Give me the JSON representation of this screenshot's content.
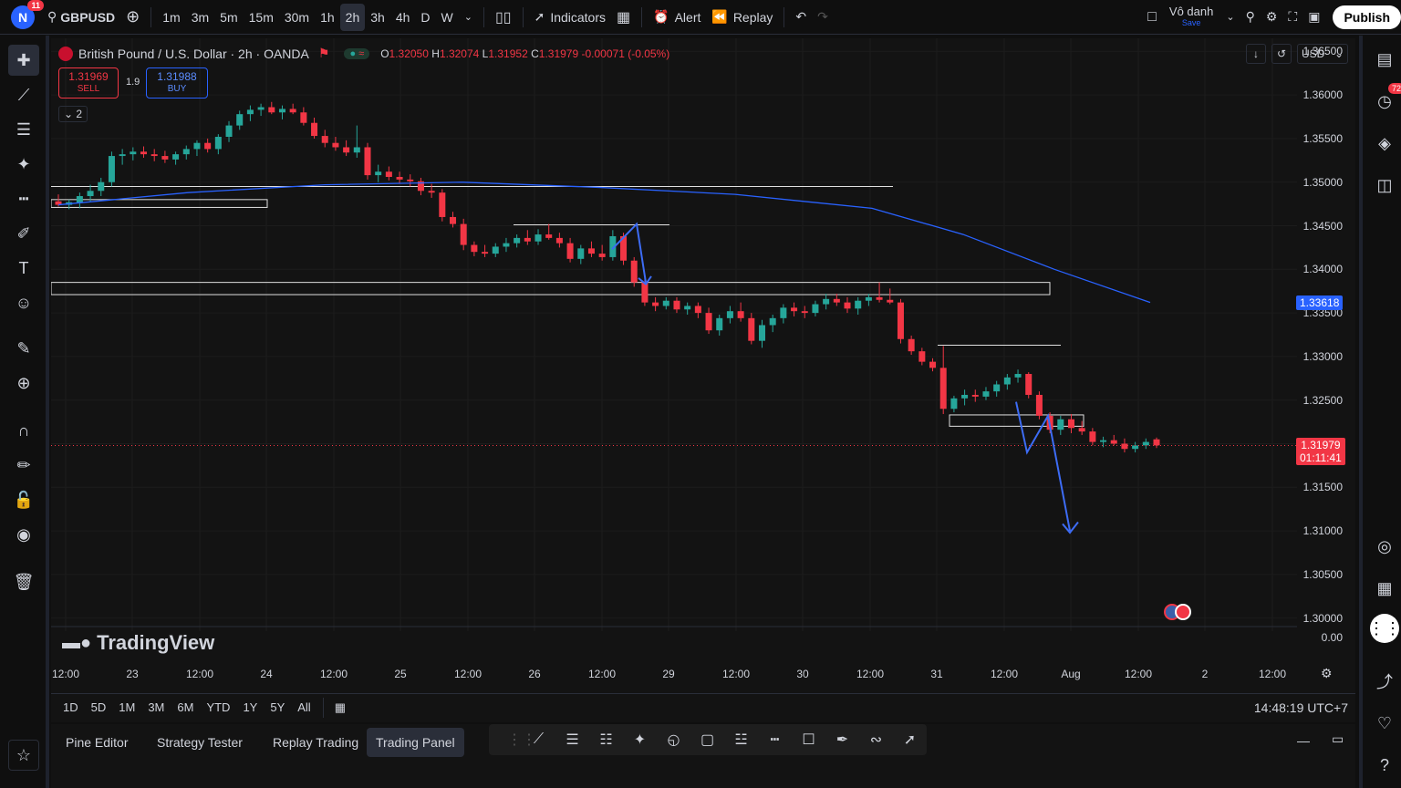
{
  "topbar": {
    "avatar_letter": "N",
    "avatar_badge": "11",
    "symbol": "GBPUSD",
    "timeframes": [
      "1m",
      "3m",
      "5m",
      "15m",
      "30m",
      "1h",
      "2h",
      "3h",
      "4h",
      "D",
      "W"
    ],
    "active_timeframe": "2h",
    "indicators_label": "Indicators",
    "alert_label": "Alert",
    "replay_label": "Replay",
    "layout_name": "Vô danh",
    "layout_status": "Save",
    "publish_label": "Publish"
  },
  "legend": {
    "title": "British Pound / U.S. Dollar · 2h · OANDA",
    "o_label": "O",
    "o": "1.32050",
    "h_label": "H",
    "h": "1.32074",
    "l_label": "L",
    "l": "1.31952",
    "c_label": "C",
    "c": "1.31979",
    "change": "-0.00071 (-0.05%)",
    "sell_price": "1.31969",
    "sell_label": "SELL",
    "spread": "1.9",
    "buy_price": "1.31988",
    "buy_label": "BUY",
    "indicator_count": "2"
  },
  "price_axis": {
    "currency": "USD",
    "ticks": [
      "1.36500",
      "1.36000",
      "1.35500",
      "1.35000",
      "1.34500",
      "1.34000",
      "1.33500",
      "1.33000",
      "1.32500",
      "1.32000",
      "1.31500",
      "1.31000",
      "1.30500",
      "1.30000",
      "0.00"
    ],
    "ma_tag": "1.33618",
    "last_price": "1.31979",
    "countdown": "01:11:41"
  },
  "time_axis": {
    "ticks": [
      "12:00",
      "23",
      "12:00",
      "24",
      "12:00",
      "25",
      "12:00",
      "26",
      "12:00",
      "29",
      "12:00",
      "30",
      "12:00",
      "31",
      "12:00",
      "Aug",
      "12:00",
      "2",
      "12:00"
    ]
  },
  "range_bar": {
    "ranges": [
      "1D",
      "5D",
      "1M",
      "3M",
      "6M",
      "YTD",
      "1Y",
      "5Y",
      "All"
    ],
    "clock": "14:48:19 UTC+7"
  },
  "bottom_tabs": [
    "Pine Editor",
    "Strategy Tester",
    "Replay Trading",
    "Trading Panel"
  ],
  "active_bottom_tab": "Trading Panel",
  "watermark": "TradingView",
  "rightbar_badge": "72",
  "colors": {
    "up": "#26a69a",
    "down": "#f23645",
    "ma": "#2962ff",
    "accent": "#2962ff"
  },
  "chart_data": {
    "type": "candlestick",
    "symbol": "GBPUSD",
    "interval": "2h",
    "ylim": [
      1.2985,
      1.3665
    ],
    "ma_end_value": 1.33618,
    "candles_ohlc": [
      [
        1.3478,
        1.3486,
        1.3472,
        1.3474
      ],
      [
        1.3474,
        1.348,
        1.3469,
        1.3477
      ],
      [
        1.3476,
        1.3488,
        1.347,
        1.3484
      ],
      [
        1.3484,
        1.3497,
        1.3478,
        1.349
      ],
      [
        1.349,
        1.3505,
        1.3484,
        1.35
      ],
      [
        1.35,
        1.3535,
        1.3495,
        1.353
      ],
      [
        1.353,
        1.3538,
        1.352,
        1.3532
      ],
      [
        1.3532,
        1.354,
        1.3525,
        1.3535
      ],
      [
        1.3535,
        1.3541,
        1.3528,
        1.3532
      ],
      [
        1.3532,
        1.3538,
        1.3524,
        1.353
      ],
      [
        1.353,
        1.3536,
        1.3522,
        1.3526
      ],
      [
        1.3526,
        1.3535,
        1.352,
        1.3532
      ],
      [
        1.3532,
        1.3542,
        1.3526,
        1.3538
      ],
      [
        1.3538,
        1.3548,
        1.353,
        1.3545
      ],
      [
        1.3545,
        1.355,
        1.3534,
        1.3538
      ],
      [
        1.3538,
        1.3555,
        1.3532,
        1.3552
      ],
      [
        1.3552,
        1.357,
        1.3546,
        1.3565
      ],
      [
        1.3565,
        1.3582,
        1.356,
        1.3578
      ],
      [
        1.3578,
        1.3588,
        1.357,
        1.3583
      ],
      [
        1.3583,
        1.359,
        1.3576,
        1.3586
      ],
      [
        1.3586,
        1.3592,
        1.3578,
        1.358
      ],
      [
        1.358,
        1.3588,
        1.3572,
        1.3584
      ],
      [
        1.3584,
        1.359,
        1.3578,
        1.358
      ],
      [
        1.358,
        1.3586,
        1.3565,
        1.3568
      ],
      [
        1.3568,
        1.3574,
        1.355,
        1.3553
      ],
      [
        1.3553,
        1.356,
        1.354,
        1.3545
      ],
      [
        1.3545,
        1.3552,
        1.3536,
        1.354
      ],
      [
        1.354,
        1.3548,
        1.353,
        1.3534
      ],
      [
        1.3534,
        1.3565,
        1.3528,
        1.354
      ],
      [
        1.354,
        1.3545,
        1.3503,
        1.3508
      ],
      [
        1.3508,
        1.352,
        1.35,
        1.3512
      ],
      [
        1.3512,
        1.3518,
        1.3502,
        1.3506
      ],
      [
        1.3506,
        1.3512,
        1.3498,
        1.3503
      ],
      [
        1.3503,
        1.3509,
        1.3495,
        1.3501
      ],
      [
        1.3501,
        1.3505,
        1.3485,
        1.349
      ],
      [
        1.349,
        1.3498,
        1.3482,
        1.3488
      ],
      [
        1.3488,
        1.3492,
        1.3455,
        1.346
      ],
      [
        1.346,
        1.3466,
        1.3448,
        1.3452
      ],
      [
        1.3452,
        1.3458,
        1.3422,
        1.3428
      ],
      [
        1.3428,
        1.3432,
        1.3415,
        1.342
      ],
      [
        1.342,
        1.3428,
        1.3414,
        1.3418
      ],
      [
        1.3418,
        1.343,
        1.3414,
        1.3426
      ],
      [
        1.3426,
        1.3436,
        1.342,
        1.343
      ],
      [
        1.343,
        1.344,
        1.3425,
        1.3436
      ],
      [
        1.3436,
        1.3445,
        1.3428,
        1.3432
      ],
      [
        1.3432,
        1.3446,
        1.3428,
        1.344
      ],
      [
        1.344,
        1.3452,
        1.3434,
        1.3436
      ],
      [
        1.3436,
        1.3442,
        1.3425,
        1.343
      ],
      [
        1.343,
        1.3436,
        1.3408,
        1.3412
      ],
      [
        1.3412,
        1.3428,
        1.3406,
        1.3424
      ],
      [
        1.3424,
        1.3432,
        1.3414,
        1.3418
      ],
      [
        1.3418,
        1.3428,
        1.341,
        1.3414
      ],
      [
        1.3414,
        1.3445,
        1.341,
        1.3438
      ],
      [
        1.3438,
        1.3442,
        1.3405,
        1.341
      ],
      [
        1.341,
        1.3414,
        1.338,
        1.3385
      ],
      [
        1.3385,
        1.339,
        1.3358,
        1.3362
      ],
      [
        1.3362,
        1.3368,
        1.3352,
        1.3358
      ],
      [
        1.3358,
        1.3368,
        1.3354,
        1.3364
      ],
      [
        1.3364,
        1.3368,
        1.335,
        1.3354
      ],
      [
        1.3354,
        1.3362,
        1.3348,
        1.3358
      ],
      [
        1.3358,
        1.3362,
        1.3344,
        1.335
      ],
      [
        1.335,
        1.3356,
        1.3326,
        1.333
      ],
      [
        1.333,
        1.3348,
        1.3324,
        1.3344
      ],
      [
        1.3344,
        1.3358,
        1.3338,
        1.3352
      ],
      [
        1.3352,
        1.3362,
        1.334,
        1.3344
      ],
      [
        1.3344,
        1.335,
        1.3314,
        1.3318
      ],
      [
        1.3318,
        1.3342,
        1.331,
        1.3336
      ],
      [
        1.3336,
        1.3348,
        1.3328,
        1.3344
      ],
      [
        1.3344,
        1.336,
        1.3338,
        1.3356
      ],
      [
        1.3356,
        1.3362,
        1.3346,
        1.3352
      ],
      [
        1.3352,
        1.3358,
        1.3344,
        1.335
      ],
      [
        1.335,
        1.3364,
        1.3346,
        1.336
      ],
      [
        1.336,
        1.3372,
        1.3354,
        1.3366
      ],
      [
        1.3366,
        1.3372,
        1.3358,
        1.3362
      ],
      [
        1.3362,
        1.3368,
        1.335,
        1.3355
      ],
      [
        1.3355,
        1.3368,
        1.3348,
        1.3364
      ],
      [
        1.3364,
        1.3372,
        1.3358,
        1.3368
      ],
      [
        1.3368,
        1.3385,
        1.3362,
        1.3365
      ],
      [
        1.3365,
        1.3378,
        1.336,
        1.3362
      ],
      [
        1.3362,
        1.3366,
        1.3315,
        1.332
      ],
      [
        1.332,
        1.3324,
        1.3302,
        1.3306
      ],
      [
        1.3306,
        1.331,
        1.329,
        1.3294
      ],
      [
        1.3294,
        1.3298,
        1.3283,
        1.3287
      ],
      [
        1.3287,
        1.3312,
        1.3234,
        1.324
      ],
      [
        1.324,
        1.3255,
        1.3236,
        1.3252
      ],
      [
        1.3252,
        1.3262,
        1.3244,
        1.3256
      ],
      [
        1.3256,
        1.3262,
        1.3248,
        1.3254
      ],
      [
        1.3254,
        1.3265,
        1.325,
        1.326
      ],
      [
        1.326,
        1.3272,
        1.3254,
        1.3268
      ],
      [
        1.3268,
        1.328,
        1.3262,
        1.3276
      ],
      [
        1.3276,
        1.3285,
        1.327,
        1.328
      ],
      [
        1.328,
        1.3282,
        1.3252,
        1.3256
      ],
      [
        1.3256,
        1.326,
        1.3228,
        1.3232
      ],
      [
        1.3232,
        1.3236,
        1.3212,
        1.3216
      ],
      [
        1.3216,
        1.3232,
        1.321,
        1.3228
      ],
      [
        1.3228,
        1.3234,
        1.3212,
        1.3218
      ],
      [
        1.3218,
        1.3226,
        1.321,
        1.3214
      ],
      [
        1.3214,
        1.3218,
        1.3198,
        1.3202
      ],
      [
        1.3202,
        1.3208,
        1.3196,
        1.3204
      ],
      [
        1.3204,
        1.321,
        1.3198,
        1.32
      ],
      [
        1.32,
        1.3206,
        1.319,
        1.3194
      ],
      [
        1.3194,
        1.3202,
        1.319,
        1.3198
      ],
      [
        1.3198,
        1.3206,
        1.3194,
        1.3202
      ],
      [
        1.3205,
        1.3207,
        1.3195,
        1.3198
      ]
    ]
  }
}
